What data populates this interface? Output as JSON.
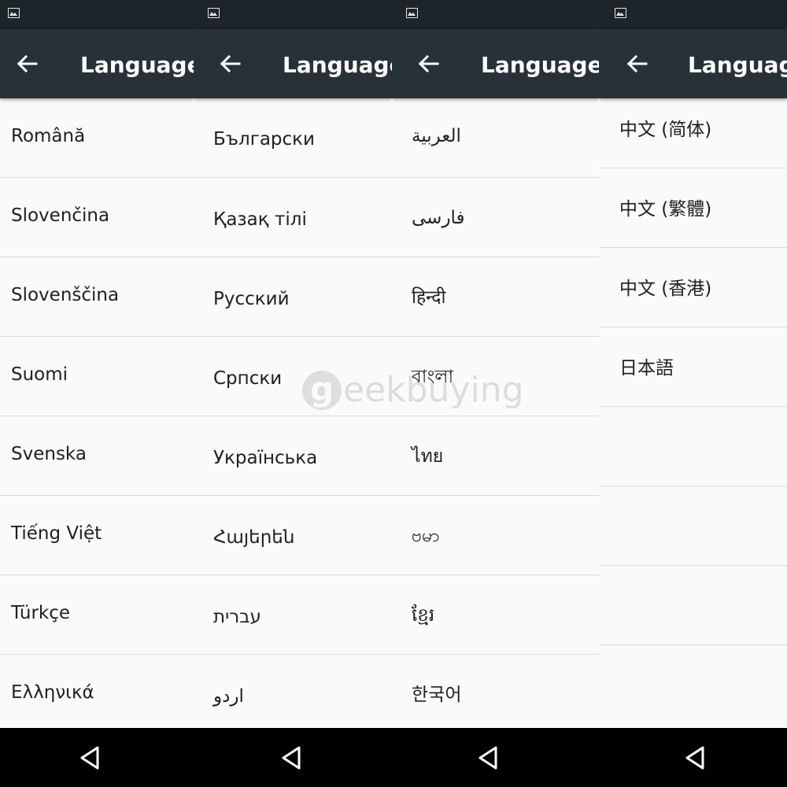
{
  "screens": [
    {
      "title": "Language",
      "items": [
        "Română",
        "Slovenčina",
        "Slovenščina",
        "Suomi",
        "Svenska",
        "Tiếng Việt",
        "Türkçe",
        "Ελληνικά"
      ]
    },
    {
      "title": "Language",
      "items": [
        "Български",
        "Қазақ тілі",
        "Русский",
        "Српски",
        "Українська",
        "Հայերեն",
        "עברית",
        "اردو"
      ]
    },
    {
      "title": "Language",
      "items": [
        "العربية",
        "فارسی",
        "हिन्दी",
        "বাংলা",
        "ไทย",
        "ဗမာ",
        "ខ្មែរ",
        "한국어"
      ]
    },
    {
      "title": "Language",
      "items": [
        "中文 (简体)",
        "中文 (繁體)",
        "中文 (香港)",
        "日本語",
        "",
        "",
        "",
        ""
      ]
    }
  ],
  "watermark": {
    "g": "g",
    "text": "eekbuying"
  },
  "colors": {
    "toolbar": "#263238",
    "statusbar": "#1e252a",
    "list_background": "#fafafa",
    "divider": "#dcdcdc",
    "text": "#212121",
    "navbar": "#000000"
  },
  "icons": {
    "status": "image-icon",
    "toolbar_back": "arrow-back-icon",
    "nav_back": "nav-back-triangle-icon"
  }
}
